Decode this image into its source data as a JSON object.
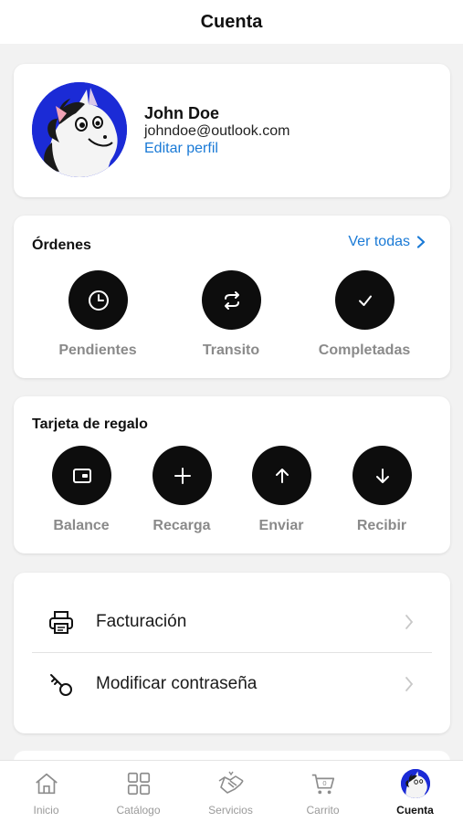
{
  "header": {
    "title": "Cuenta"
  },
  "profile": {
    "name": "John Doe",
    "email": "johndoe@outlook.com",
    "edit_label": "Editar perfil"
  },
  "orders": {
    "title": "Órdenes",
    "view_all": "Ver todas",
    "items": [
      {
        "label": "Pendientes",
        "icon": "clock-icon"
      },
      {
        "label": "Transito",
        "icon": "repeat-icon"
      },
      {
        "label": "Completadas",
        "icon": "check-icon"
      }
    ]
  },
  "gift_card": {
    "title": "Tarjeta de regalo",
    "items": [
      {
        "label": "Balance",
        "icon": "wallet-icon"
      },
      {
        "label": "Recarga",
        "icon": "plus-icon"
      },
      {
        "label": "Enviar",
        "icon": "arrow-up-icon"
      },
      {
        "label": "Recibir",
        "icon": "arrow-down-icon"
      }
    ]
  },
  "menu": {
    "items": [
      {
        "label": "Facturación",
        "icon": "printer-icon"
      },
      {
        "label": "Modificar contraseña",
        "icon": "key-icon"
      }
    ]
  },
  "tabbar": {
    "items": [
      {
        "label": "Inicio",
        "icon": "home-icon"
      },
      {
        "label": "Catálogo",
        "icon": "grid-icon"
      },
      {
        "label": "Servicios",
        "icon": "handshake-icon"
      },
      {
        "label": "Carrito",
        "icon": "cart-icon",
        "badge": "0"
      },
      {
        "label": "Cuenta",
        "icon": "avatar-icon",
        "active": true
      }
    ]
  },
  "colors": {
    "accent": "#1a7ad6",
    "button_bg": "#0d0d0d",
    "muted_label": "#8a8a8a",
    "page_bg": "#f2f2f2",
    "avatar_bg": "#1b2bd6"
  }
}
